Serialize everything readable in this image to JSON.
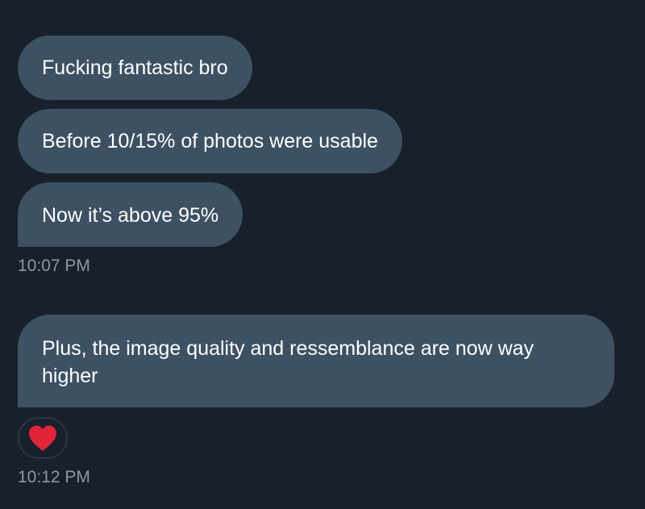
{
  "colors": {
    "background": "#17202b",
    "bubble": "#3d5163",
    "bubble_text": "#ffffff",
    "timestamp": "#8b98a5",
    "heart": "#e0243a"
  },
  "messages": [
    {
      "text": "Fucking fantastic bro"
    },
    {
      "text": "Before 10/15% of photos were usable"
    },
    {
      "text": "Now it’s above 95%"
    },
    {
      "text": "Plus, the image quality and ressemblance are now way higher"
    }
  ],
  "timestamps": {
    "first_group": "10:07 PM",
    "second_group": "10:12 PM"
  },
  "reaction": {
    "icon": "red-heart-icon"
  }
}
